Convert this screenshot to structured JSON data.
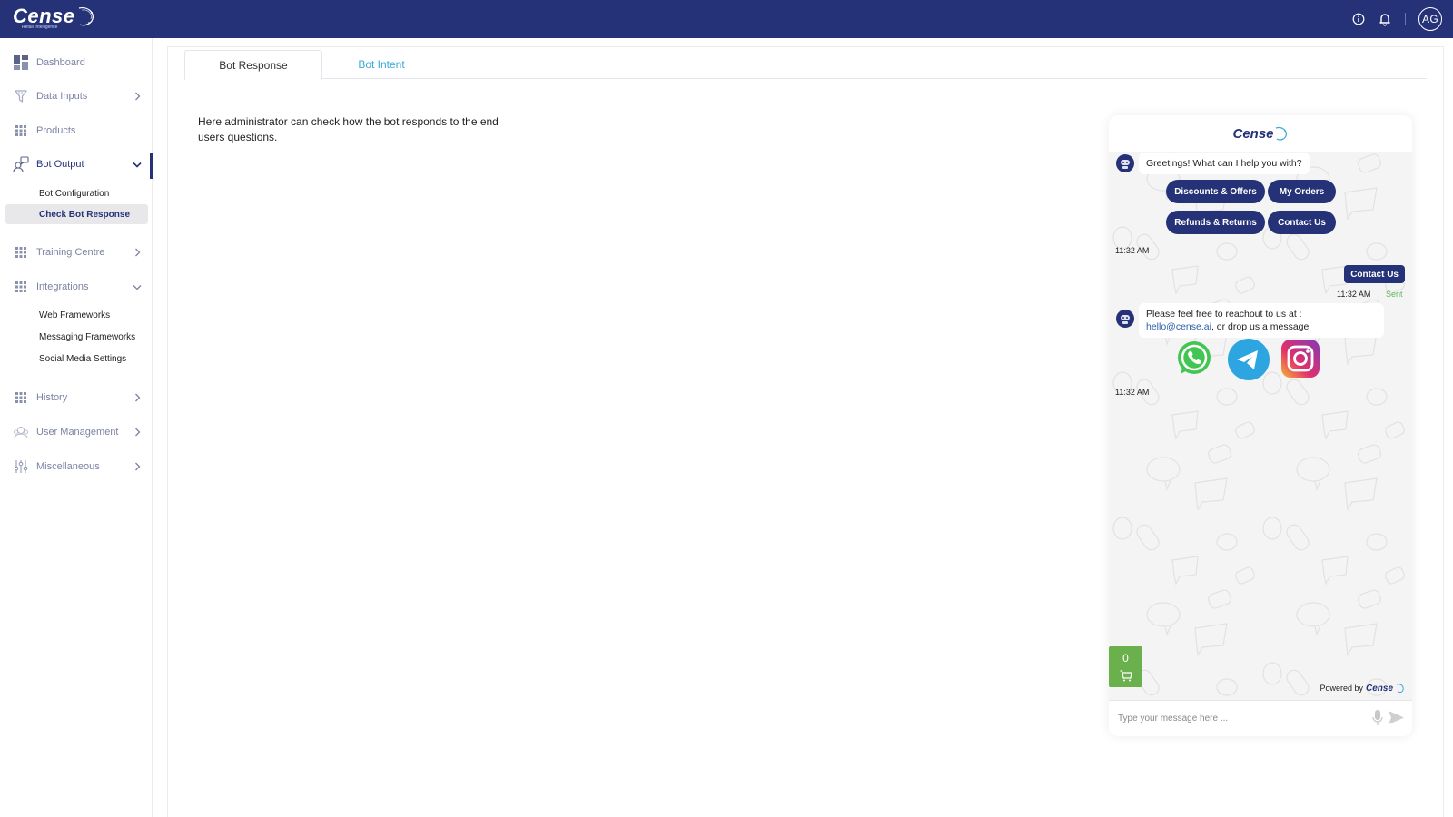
{
  "header": {
    "logo_text": "Cense",
    "logo_tagline": "Retail Intelligence",
    "avatar_initials": "AG",
    "icons": [
      "info-icon",
      "bell-icon"
    ]
  },
  "sidebar": {
    "items": [
      {
        "label": "Dashboard",
        "icon": "dashboard-icon",
        "chevron": "none"
      },
      {
        "label": "Data Inputs",
        "icon": "funnel-icon",
        "chevron": "right"
      },
      {
        "label": "Products",
        "icon": "grid-icon",
        "chevron": "none"
      },
      {
        "label": "Bot Output",
        "icon": "bot-output-icon",
        "chevron": "down",
        "active": true
      },
      {
        "label": "Training Centre",
        "icon": "grid-icon",
        "chevron": "right"
      },
      {
        "label": "Integrations",
        "icon": "grid-icon",
        "chevron": "down"
      },
      {
        "label": "History",
        "icon": "grid-icon",
        "chevron": "right"
      },
      {
        "label": "User Management",
        "icon": "users-icon",
        "chevron": "right"
      },
      {
        "label": "Miscellaneous",
        "icon": "sliders-icon",
        "chevron": "right"
      }
    ],
    "bot_output_sub": [
      {
        "label": "Bot Configuration"
      },
      {
        "label": "Check Bot Response",
        "selected": true
      }
    ],
    "integrations_sub": [
      {
        "label": "Web Frameworks"
      },
      {
        "label": "Messaging Frameworks"
      },
      {
        "label": "Social Media Settings"
      }
    ]
  },
  "main": {
    "tabs": [
      {
        "label": "Bot Response",
        "active": true
      },
      {
        "label": "Bot Intent",
        "active": false
      }
    ],
    "description": "Here administrator can check how the bot responds to the end users questions."
  },
  "chat": {
    "header_logo": "Cense",
    "messages": {
      "greeting": "Greetings! What can I help you with?",
      "quick_replies": [
        "Discounts & Offers",
        "My Orders",
        "Refunds & Returns",
        "Contact Us"
      ],
      "greeting_time": "11:32 AM",
      "user_message": "Contact Us",
      "user_time": "11:32 AM",
      "user_status": "Sent",
      "reply_line1": "Please feel free to reachout to us at :",
      "reply_email": "hello@cense.ai",
      "reply_line2_rest": ", or drop us a message",
      "reply_time": "11:32 AM",
      "social": [
        "whatsapp-icon",
        "telegram-icon",
        "instagram-icon"
      ]
    },
    "cart_count": "0",
    "powered_by": "Powered by",
    "powered_logo": "Cense",
    "input_placeholder": "Type your message here ...",
    "input_value": ""
  },
  "colors": {
    "brand": "#253278",
    "tab_inactive": "#38a9d8",
    "cart": "#6ab04c",
    "sent": "#5cb85c"
  }
}
